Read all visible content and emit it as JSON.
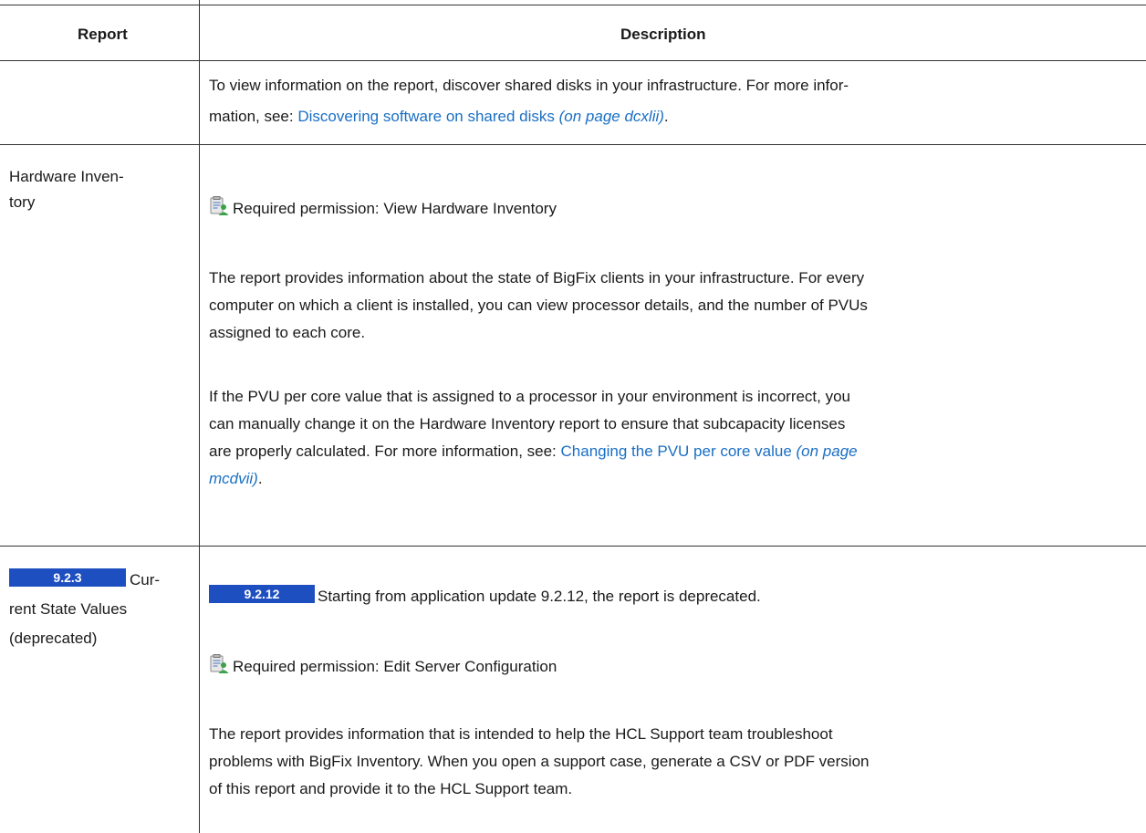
{
  "headers": {
    "report": "Report",
    "description": "Description"
  },
  "row1": {
    "desc_line1": "To view information on the report, discover shared disks in your infrastructure. For more infor-",
    "desc_line2_prefix": "mation, see: ",
    "link_text": "Discovering software on shared disks",
    "link_page": "(on page dcxlii)",
    "suffix": "."
  },
  "row2": {
    "report_line1": "Hardware Inven-",
    "report_line2": "tory",
    "permission": "Required permission: View Hardware Inventory",
    "p1_l1": "The report provides information about the state of BigFix clients in your infrastructure. For every",
    "p1_l2": "computer on which a client is installed, you can view processor details, and the number of PVUs",
    "p1_l3": "assigned to each core.",
    "p2_l1": "If the PVU per core value that is assigned to a processor in your environment is incorrect, you",
    "p2_l2": "can manually change it on the Hardware Inventory report to ensure that subcapacity licenses",
    "p2_l3_prefix": "are properly calculated. For more information, see: ",
    "link_text": "Changing the PVU per core value",
    "link_page_a": "(on page",
    "link_page_b": "mcdvii)",
    "suffix": "."
  },
  "row3": {
    "badge_version": "9.2.3",
    "report_line1": "Cur-",
    "report_line2": "rent State Values",
    "report_line3": "(deprecated)",
    "badge_deprecated": "9.2.12",
    "deprecated_text": "Starting from application update 9.2.12, the report is deprecated.",
    "permission": "Required permission: Edit Server Configuration",
    "p1_l1": "The report provides information that is intended to help the HCL Support team troubleshoot",
    "p1_l2": "problems with BigFix Inventory. When you open a support case, generate a CSV or PDF version",
    "p1_l3": "of this report and provide it to the HCL Support team."
  },
  "colors": {
    "badge": "#1e4fc0",
    "link": "#1a6fc4",
    "rule": "#333333"
  },
  "icons": {
    "permission": "permission-user-icon"
  }
}
